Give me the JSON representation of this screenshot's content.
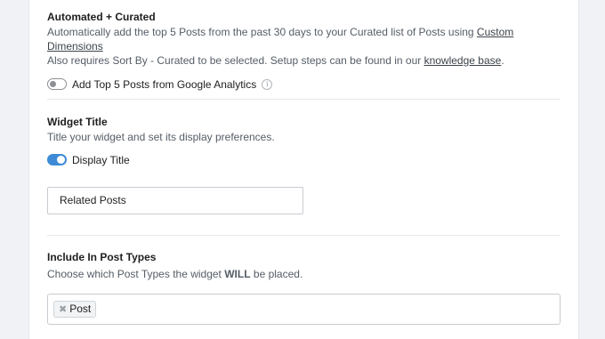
{
  "automated": {
    "heading": "Automated + Curated",
    "desc_line1_prefix": "Automatically add the top 5 Posts from the past 30 days to your Curated list of Posts using ",
    "desc_line1_link": "Custom Dimensions",
    "desc_line2_prefix": "Also requires Sort By - Curated to be selected. Setup steps can be found in our ",
    "desc_line2_link": "knowledge base",
    "desc_line2_suffix": ".",
    "toggle_label": "Add Top 5 Posts from Google Analytics",
    "toggle_on": false,
    "info_icon": "info-icon"
  },
  "widget_title": {
    "heading": "Widget Title",
    "desc": "Title your widget and set its display preferences.",
    "toggle_label": "Display Title",
    "toggle_on": true,
    "input_value": "Related Posts"
  },
  "post_types": {
    "heading": "Include In Post Types",
    "desc_prefix": "Choose which Post Types the widget ",
    "desc_bold": "WILL",
    "desc_suffix": " be placed.",
    "tags": [
      {
        "label": "Post",
        "remove_glyph": "✖"
      }
    ]
  },
  "colors": {
    "accent": "#3d8bd6",
    "background": "#f0f2f5",
    "panel": "#ffffff"
  }
}
